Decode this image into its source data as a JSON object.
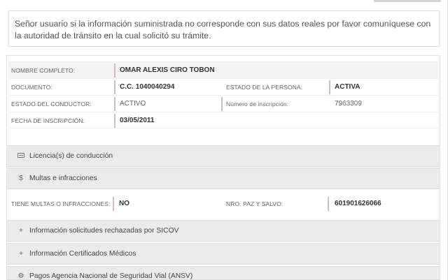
{
  "notice": {
    "text": "Señor usuario si la información suministrada no corresponde con sus datos reales por favor comuníquese con la autoridad de tránsito en la cual solicitó su trámite."
  },
  "person": {
    "nombre_label": "NOMBRE COMPLETO:",
    "nombre_value": "OMAR ALEXIS CIRO TOBON",
    "documento_label": "DOCUMENTO:",
    "documento_value": "C.C. 1040040294",
    "estado_persona_label": "ESTADO DE LA PERSONA:",
    "estado_persona_value": "ACTIVA",
    "estado_conductor_label": "ESTADO DEL CONDUCTOR:",
    "estado_conductor_value": "ACTIVO",
    "numero_inscripcion_label": "Número de inscripción:",
    "numero_inscripcion_value": "7963309",
    "fecha_inscripcion_label": "FECHA DE INSCRIPCIÓN:",
    "fecha_inscripcion_value": "03/05/2011"
  },
  "sections": {
    "licencias": {
      "label": "Licencia(s) de conducción",
      "icon": "id-card-icon"
    },
    "multas": {
      "label": "Multas e infracciones",
      "icon": "dollar-icon"
    },
    "sicov": {
      "label": "Información solicitudes rechazadas por SICOV",
      "icon": "plus-icon"
    },
    "certificados": {
      "label": "Información Certificados Médicos",
      "icon": "plus-icon"
    },
    "ansv": {
      "label": "Pagos Agencia Nacional de Seguridad Vial (ANSV)",
      "icon": "gear-icon"
    }
  },
  "multas": {
    "tiene_label": "TIENE MULTAS O INFRACCIONES:",
    "tiene_value": "NO",
    "paz_salvo_label": "NRO. PAZ Y SALVO:",
    "paz_salvo_value": "601901626066"
  }
}
